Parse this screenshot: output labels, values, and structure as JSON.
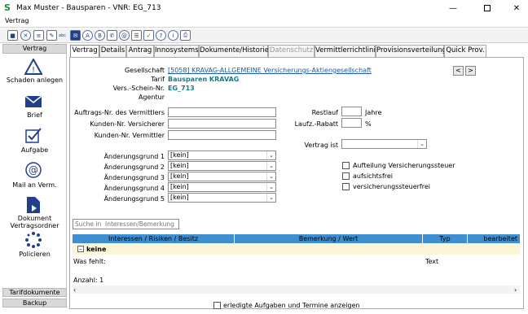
{
  "window": {
    "title": "Max Muster - Bausparen - VNR: EG_713",
    "logo": "S"
  },
  "menu": {
    "label": "Vertrag"
  },
  "toolbar": {
    "icons": [
      "save-icon",
      "cancel-icon",
      "list-icon",
      "edit-icon",
      "card-icon",
      "text-a-icon",
      "text-b-icon",
      "phone-icon",
      "at-icon",
      "email-icon",
      "checkbox-icon",
      "help-icon",
      "info-icon",
      "print-icon"
    ]
  },
  "sidebar": {
    "header": "Vertrag",
    "items": [
      {
        "label": "Schaden anlegen"
      },
      {
        "label": "Brief"
      },
      {
        "label": "Aufgabe"
      },
      {
        "label": "Mail an Verm."
      },
      {
        "label": "Dokument Vertragsordner"
      },
      {
        "label": "Policieren"
      }
    ],
    "footer1": "Tarifdokumente",
    "footer2": "Backup"
  },
  "tabs": [
    "Vertrag",
    "Details",
    "Antrag",
    "Innosystems",
    "Dokumente/Historie",
    "Datenschutz",
    "Vermittlerrichtlinie",
    "Provisionsverteilung",
    "Quick Prov."
  ],
  "header_info": {
    "gesellschaft_label": "Gesellschaft",
    "gesellschaft_value": "[5058] KRAVAG-ALLGEMEINE Versicherungs-Aktiengesellschaft",
    "tarif_label": "Tarif",
    "tarif_value": "Bausparen KRAVAG",
    "vsnr_label": "Vers.-Schein-Nr.",
    "vsnr_value": "EG_713",
    "agentur_label": "Agentur",
    "nav_prev": "<",
    "nav_next": ">"
  },
  "form": {
    "auftrag_label": "Auftrags-Nr. des Vermittlers",
    "kunden_vers_label": "Kunden-Nr. Versicherer",
    "kunden_verm_label": "Kunden-Nr. Vermittler",
    "restlauf_label": "Restlauf",
    "jahre_label": "Jahre",
    "laufz_label": "Laufz.-Rabatt",
    "pct_label": "%",
    "vertrag_ist_label": "Vertrag ist",
    "aenderung1_label": "Änderungsgrund 1",
    "aenderung2_label": "Änderungsgrund 2",
    "aenderung3_label": "Änderungsgrund 3",
    "aenderung4_label": "Änderungsgrund 4",
    "aenderung5_label": "Änderungsgrund 5",
    "aenderung_value": "[kein]",
    "cb_aufteilung": "Aufteilung Versicherungssteuer",
    "cb_aufsicht": "aufsichtsfrei",
    "cb_steuerfrei": "versicherungssteuerfrei"
  },
  "search": {
    "placeholder": "Suche in  Interessen/Bemerkung"
  },
  "grid": {
    "columns": [
      "Interessen / Risiken / Besitz",
      "Bemerkung / Wert",
      "Typ",
      "bearbeitet"
    ],
    "group_label": "keine",
    "row_label": "Was fehlt:",
    "row_typ": "Text",
    "count": "Anzahl: 1"
  },
  "footer": {
    "checkbox_label": "erledigte Aufgaben und Termine anzeigen"
  }
}
